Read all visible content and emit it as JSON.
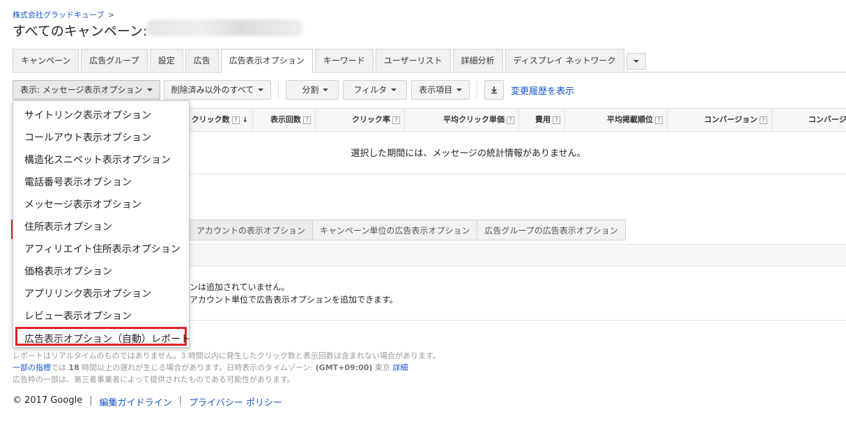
{
  "header": {
    "breadcrumb": "株式会社グラッドキューブ",
    "breadcrumb_sep": ">",
    "title": "すべてのキャンペーン:"
  },
  "tabs": [
    {
      "label": "キャンペーン"
    },
    {
      "label": "広告グループ"
    },
    {
      "label": "設定"
    },
    {
      "label": "広告"
    },
    {
      "label": "広告表示オプション",
      "active": true
    },
    {
      "label": "キーワード"
    },
    {
      "label": "ユーザーリスト"
    },
    {
      "label": "詳細分析"
    },
    {
      "label": "ディスプレイ ネットワーク"
    }
  ],
  "toolbar": {
    "view_label": "表示: メッセージ表示オプション",
    "filter_status_label": "削除済み以外のすべて",
    "segment_label": "分割",
    "filter_label": "フィルタ",
    "columns_label": "表示項目",
    "history_link": "変更履歴を表示"
  },
  "table": {
    "headers": [
      "クリック数",
      "表示回数",
      "クリック率",
      "平均クリック単価",
      "費用",
      "平均掲載順位",
      "コンバージョン",
      "コンバージ"
    ],
    "help_glyph": "?",
    "sort_glyph": "↓",
    "no_stats": "選択した期間には、メッセージの統計情報がありません。"
  },
  "subtabs": [
    "アカウントの表示オプション",
    "キャンペーン単位の広告表示オプション",
    "広告グループの広告表示オプション"
  ],
  "notices": {
    "line1": "ンは追加されていません。",
    "line2": "アカウント単位で広告表示オプションを追加できます。"
  },
  "notes": {
    "line1": "レポートはリアルタイムのものではありません。3 時間以内に発生したクリック数と表示回数は含まれない場合があります。",
    "line2_link": "一部の指標",
    "line2_a": "では ",
    "line2_bold1": "18",
    "line2_b": " 時間以上の遅れが生じる場合があります。日時表示のタイムゾーン: ",
    "line2_bold2": "(GMT+09:00)",
    "line2_c": " 東京 ",
    "line2_link2": "詳細",
    "line3": "広告枠の一部は、第三者事業者によって提供されたものである可能性があります。"
  },
  "footer": {
    "copyright": "© 2017 Google",
    "sep": "|",
    "guidelines": "編集ガイドライン",
    "privacy": "プライバシー ポリシー"
  },
  "menu": {
    "items": [
      "サイトリンク表示オプション",
      "コールアウト表示オプション",
      "構造化スニペット表示オプション",
      "電話番号表示オプション",
      "メッセージ表示オプション",
      "住所表示オプション",
      "アフィリエイト住所表示オプション",
      "価格表示オプション",
      "アプリリンク表示オプション",
      "レビュー表示オプション",
      "広告表示オプション（自動）レポート"
    ],
    "highlight_color": "#e0202a"
  },
  "colors": {
    "link": "#1155cc",
    "highlight": "#e0202a"
  }
}
